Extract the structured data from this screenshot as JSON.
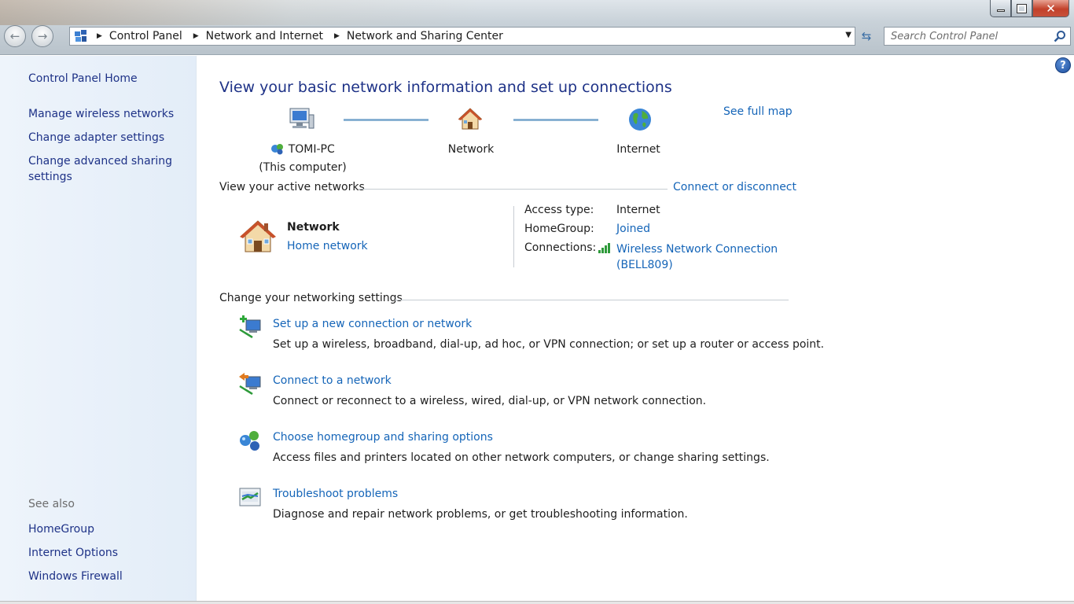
{
  "window": {
    "buttons": {
      "minimize": "minimize-icon",
      "maximize": "restore-icon",
      "close": "close-icon"
    }
  },
  "address_bar": {
    "breadcrumbs": [
      "Control Panel",
      "Network and Internet",
      "Network and Sharing Center"
    ]
  },
  "search": {
    "placeholder": "Search Control Panel"
  },
  "sidebar": {
    "home": "Control Panel Home",
    "links": [
      "Manage wireless networks",
      "Change adapter settings",
      "Change advanced sharing",
      "settings"
    ],
    "see_also_label": "See also",
    "see_also": [
      "HomeGroup",
      "Internet Options",
      "Windows Firewall"
    ]
  },
  "main": {
    "title": "View your basic network information and set up connections",
    "see_full_map": "See full map",
    "map": {
      "computer_name": "TOMI-PC",
      "computer_sub": "(This computer)",
      "network": "Network",
      "internet": "Internet"
    },
    "active_networks": {
      "heading": "View your active networks",
      "connect_link": "Connect or disconnect",
      "network_name": "Network",
      "network_type": "Home network",
      "access_type_label": "Access type:",
      "access_type_value": "Internet",
      "homegroup_label": "HomeGroup:",
      "homegroup_value": "Joined",
      "connections_label": "Connections:",
      "connection_name_1": "Wireless Network Connection",
      "connection_name_2": "(BELL809)"
    },
    "settings": {
      "heading": "Change your networking settings",
      "tasks": [
        {
          "title": "Set up a new connection or network",
          "desc": "Set up a wireless, broadband, dial-up, ad hoc, or VPN connection; or set up a router or access point."
        },
        {
          "title": "Connect to a network",
          "desc": "Connect or reconnect to a wireless, wired, dial-up, or VPN network connection."
        },
        {
          "title": "Choose homegroup and sharing options",
          "desc": "Access files and printers located on other network computers, or change sharing settings."
        },
        {
          "title": "Troubleshoot problems",
          "desc": "Diagnose and repair network problems, or get troubleshooting information."
        }
      ]
    }
  },
  "colors": {
    "link": "#1565b8",
    "title": "#1e3287",
    "sidebar_bg": "#e3edf8"
  }
}
